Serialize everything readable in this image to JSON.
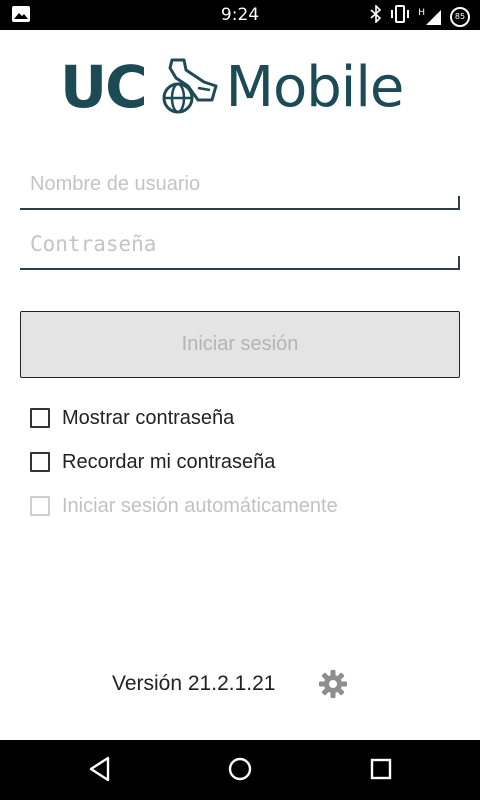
{
  "status_bar": {
    "time": "9:24",
    "battery_level": "85",
    "network_type": "H",
    "icons": [
      "image-icon",
      "bluetooth-icon",
      "vibrate-icon",
      "signal-icon",
      "battery-icon"
    ]
  },
  "logo": {
    "left_text": "UC",
    "right_text": "Mobile",
    "brand_color": "#1d4b55"
  },
  "form": {
    "username_placeholder": "Nombre de usuario",
    "password_placeholder": "Contraseña",
    "login_label": "Iniciar sesión"
  },
  "options": [
    {
      "label": "Mostrar contraseña",
      "checked": false,
      "enabled": true
    },
    {
      "label": "Recordar mi contraseña",
      "checked": false,
      "enabled": true
    },
    {
      "label": "Iniciar sesión automáticamente",
      "checked": false,
      "enabled": false
    }
  ],
  "footer": {
    "version": "Versión 21.2.1.21"
  },
  "nav": {
    "icons": [
      "back-icon",
      "home-icon",
      "recents-icon"
    ]
  }
}
